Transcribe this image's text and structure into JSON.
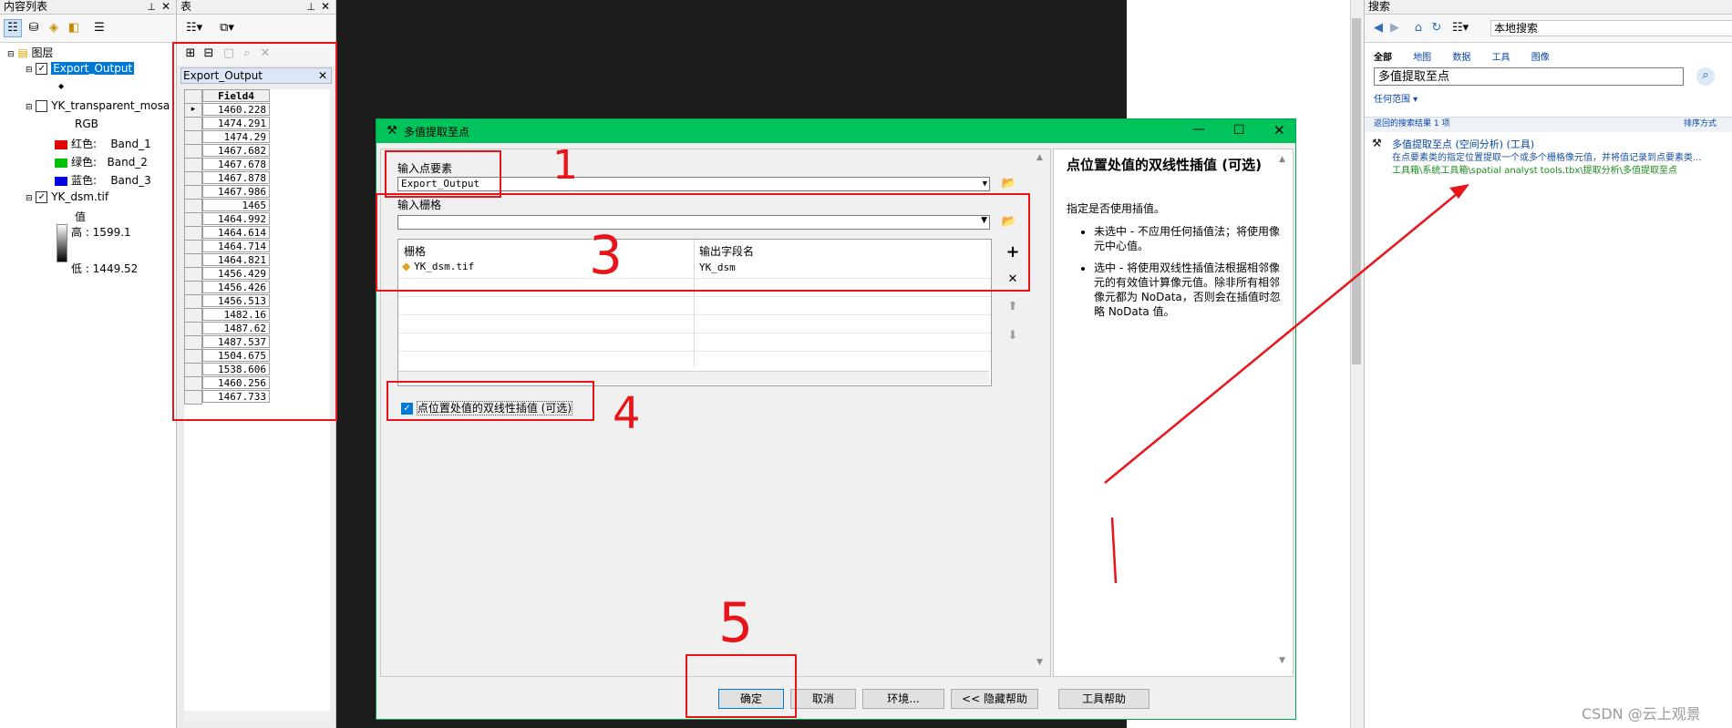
{
  "toc": {
    "title": "内容列表",
    "root_label": "图层",
    "layers": [
      {
        "name": "Export_Output",
        "checked": true,
        "selected": true
      },
      {
        "name": "YK_transparent_mosa",
        "checked": false,
        "sub": "RGB"
      },
      {
        "name": "YK_dsm.tif",
        "checked": true,
        "sub": "值"
      }
    ],
    "bands": [
      {
        "label": "红色:",
        "band": "Band_1",
        "color": "#e00000"
      },
      {
        "label": "绿色:",
        "band": "Band_2",
        "color": "#00c000"
      },
      {
        "label": "蓝色:",
        "band": "Band_3",
        "color": "#0000e0"
      }
    ],
    "high_label": "高 : 1599.1",
    "low_label": "低 : 1449.52"
  },
  "table": {
    "title": "表",
    "tab_name": "Export_Output",
    "column": "Field4",
    "values": [
      "1460.228",
      "1474.291",
      "1474.29",
      "1467.682",
      "1467.678",
      "1467.878",
      "1467.986",
      "1465",
      "1464.992",
      "1464.614",
      "1464.714",
      "1464.821",
      "1456.429",
      "1456.426",
      "1456.513",
      "1482.16",
      "1487.62",
      "1487.537",
      "1504.675",
      "1538.606",
      "1460.256",
      "1467.733"
    ]
  },
  "dialog": {
    "title": "多值提取至点",
    "input_points_label": "输入点要素",
    "input_points_value": "Export_Output",
    "input_raster_label": "输入栅格",
    "grid_col1": "栅格",
    "grid_col2": "输出字段名",
    "grid_row_raster": "YK_dsm.tif",
    "grid_row_field": "YK_dsm",
    "checkbox_label": "点位置处值的双线性插值 (可选)",
    "ok": "确定",
    "cancel": "取消",
    "env": "环境...",
    "hide_help": "<< 隐藏帮助",
    "tool_help": "工具帮助",
    "help_title": "点位置处值的双线性插值 (可选)",
    "help_intro": "指定是否使用插值。",
    "help_bullets": [
      "未选中 - 不应用任何插值法；将使用像元中心值。",
      "选中 - 将使用双线性插值法根据相邻像元的有效值计算像元值。除非所有相邻像元都为 NoData，否则会在插值时忽略 NoData 值。"
    ]
  },
  "search": {
    "title": "搜索",
    "scope": "本地搜索",
    "tabs": [
      "全部",
      "地图",
      "数据",
      "工具",
      "图像"
    ],
    "query": "多值提取至点",
    "any_extent": "任何范围",
    "results_count": "返回的搜索结果 1 项",
    "sort": "排序方式",
    "result_title": "多值提取至点 (空间分析) (工具)",
    "result_desc": "在点要素类的指定位置提取一个或多个栅格像元值，并将值记录到点要素类...",
    "result_path": "工具箱\\系统工具箱\\spatial analyst tools.tbx\\提取分析\\多值提取至点"
  },
  "annotations": [
    "1",
    "3",
    "4",
    "5"
  ],
  "watermark": "CSDN @云上观景",
  "colors": {
    "dialog_title_bg": "#00c35c",
    "annotation_red": "#e8141a",
    "map_bg": "#1e1e1e"
  }
}
